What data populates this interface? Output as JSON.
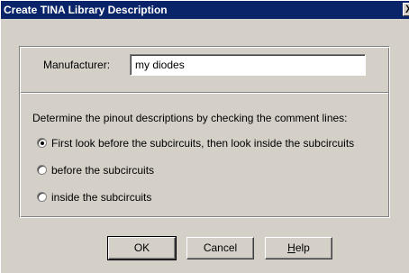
{
  "window": {
    "title": "Create TINA Library Description",
    "close_glyph": "X"
  },
  "manufacturer": {
    "label": "Manufacturer:",
    "value": "my diodes"
  },
  "pinout": {
    "instruction": "Determine the pinout descriptions by checking the comment lines:",
    "options": [
      {
        "label": "First look before the subcircuits, then look inside the subcircuits",
        "selected": true
      },
      {
        "label": "before the subcircuits",
        "selected": false
      },
      {
        "label": "inside the subcircuits",
        "selected": false
      }
    ]
  },
  "buttons": {
    "ok": "OK",
    "cancel": "Cancel",
    "help_mnemonic": "H",
    "help_rest": "elp"
  }
}
